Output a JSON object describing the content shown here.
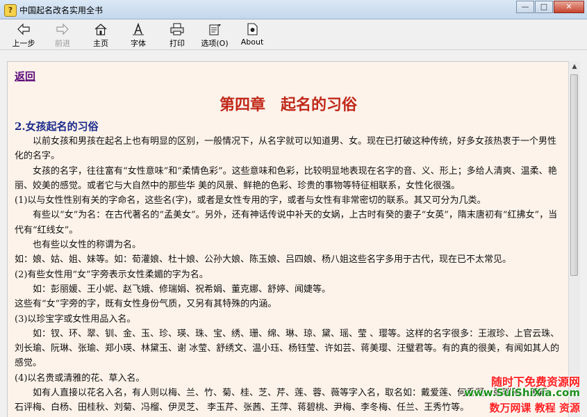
{
  "window": {
    "title": "中国起名改名实用全书",
    "app_icon": "?",
    "buttons": {
      "minimize": "—",
      "maximize": "□",
      "close": "✕"
    }
  },
  "toolbar": {
    "back": "上一步",
    "forward": "前进",
    "home": "主页",
    "font": "字体",
    "print": "打印",
    "options": "选项(O)",
    "about": "About"
  },
  "content": {
    "back_link": "返回",
    "chapter_title": "第四章　起名的习俗",
    "section_heading": "2.女孩起名的习俗",
    "paragraphs": [
      {
        "indent": true,
        "text": "以前女孩和男孩在起名上也有明显的区别，一般情况下，从名字就可以知道男、女。现在已打破这种传统，好多女孩热衷于一个男性化的名字。"
      },
      {
        "indent": true,
        "text": "女孩的名字，往往富有“女性意味”和“柔情色彩”。这些意味和色彩，比较明显地表现在名字的音、义、形上；多给人清爽、温柔、艳丽、姣美的感觉。或者它与大自然中的那些华 美的风景、鲜艳的色彩、珍贵的事物等特征相联系，女性化很强。"
      },
      {
        "indent": false,
        "text": "(1)以与女性性别有关的字命名，这些名(字)，或者是女性专用的字，或者与女性有非常密切的联系。其又可分为几类。"
      },
      {
        "indent": true,
        "text": "有些以“女”为名：在古代著名的“孟美女”。另外，还有神话传说中补天的女娲，上古时有癸的妻子“女英”，隋末唐初有“红拂女”，当代有“红线女”。"
      },
      {
        "indent": true,
        "text": "也有些以女性的称谓为名。"
      },
      {
        "indent": false,
        "text": "如：娘、姑、姐、妹等。如：荀灌娘、杜十娘、公孙大娘、陈玉娘、吕四娘、杨八姐这些名字多用于古代，现在已不太常见。"
      },
      {
        "indent": false,
        "text": "(2)有些女性用“女”字旁表示女性柔媚的字为名。"
      },
      {
        "indent": true,
        "text": "如：彭丽媛、王小妮、赵飞娥、修瑞娟、祝希娟、董克娜、舒婷、闻婕等。"
      },
      {
        "indent": false,
        "text": "这些有“女”字旁的字，既有女性身份气质，又另有其特殊的内涵。"
      },
      {
        "indent": false,
        "text": "(3)以珍宝字或女性用品入名。"
      },
      {
        "indent": true,
        "text": "如：钗、环、翠、钏、金、玉、珍、瑛、珠、宝、绣、珊、绵、琳、琼、黛、瑶、莹 、璎等。这样的名字很多：王淑珍、上官云珠、刘长瑜、阮琳、张瑜、郑小瑛、林黛玉、谢 冰莹、舒绣文、温小珏、杨钰莹、许如芸、蒋美璎、汪璧君等。有的真的很美，有闻如其人的感觉。"
      },
      {
        "indent": false,
        "text": "(4)以名贵或清雅的花、草入名。"
      },
      {
        "indent": true,
        "text": "如有人直接以花名入名，有人则以梅、兰、竹、菊、桂、芝、芹、莲、蓉、薇等字入名，取名如：戴爱莲、何香凝、张瑞芳、王颖、石评梅、白杨、田桂秋、刘菊、冯榴、伊灵芝、 李玉芹、张茜、王萍、蒋碧桃、尹梅、李冬梅、任兰、王秀竹等。"
      }
    ]
  },
  "watermark": {
    "line1": "随时下免费资源网",
    "line2": "www.SuiShiXia.com",
    "line3": "数万网课 教程 资源"
  },
  "colors": {
    "content_bg": "#fdf3ea",
    "chapter_title": "#c0281a",
    "section_heading": "#1a2a8a",
    "link": "#5c0a7a"
  }
}
